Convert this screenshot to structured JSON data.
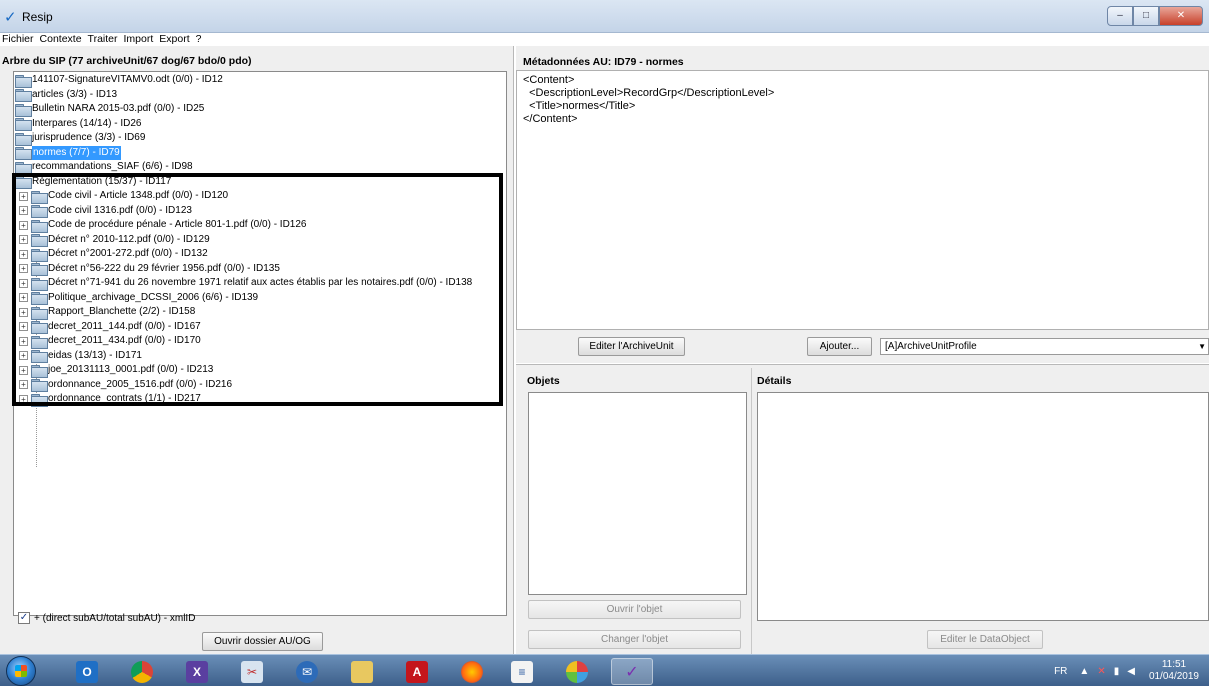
{
  "window": {
    "title": "Resip",
    "controls": {
      "minimize": "–",
      "maximize": "□",
      "close": "✕"
    }
  },
  "menu": [
    "Fichier",
    "Contexte",
    "Traiter",
    "Import",
    "Export",
    "?"
  ],
  "left": {
    "header": "Arbre du SIP (77 archiveUnit/67 dog/67 bdo/0 pdo)",
    "tree_top": [
      {
        "label": "141107-SignatureVITAMV0.odt (0/0) - ID12",
        "selected": false
      },
      {
        "label": "articles (3/3) - ID13",
        "selected": false
      },
      {
        "label": "Bulletin NARA 2015-03.pdf (0/0) - ID25",
        "selected": false
      },
      {
        "label": "Interpares (14/14) - ID26",
        "selected": false
      },
      {
        "label": "jurisprudence (3/3) - ID69",
        "selected": false
      },
      {
        "label": "normes (7/7) - ID79",
        "selected": true
      },
      {
        "label": "recommandations_SIAF (6/6) - ID98",
        "selected": false
      },
      {
        "label": "Réglementation (15/37) - ID117",
        "selected": false
      }
    ],
    "tree_children": [
      "Code civil - Article 1348.pdf (0/0) - ID120",
      "Code civil 1316.pdf (0/0) - ID123",
      "Code de procédure pénale - Article 801-1.pdf (0/0) - ID126",
      "Décret n° 2010-112.pdf (0/0) - ID129",
      "Décret n°2001-272.pdf (0/0) - ID132",
      "Décret n°56-222 du 29 février 1956.pdf (0/0) - ID135",
      "Décret n°71-941 du 26 novembre 1971 relatif aux actes établis par les notaires.pdf (0/0) - ID138",
      "Politique_archivage_DCSSI_2006 (6/6) - ID139",
      "Rapport_Blanchette (2/2) - ID158",
      "decret_2011_144.pdf (0/0) - ID167",
      "decret_2011_434.pdf (0/0) - ID170",
      "eidas (13/13) - ID171",
      "joe_20131113_0001.pdf (0/0) - ID213",
      "ordonnance_2005_1516.pdf (0/0) - ID216",
      "ordonnance_contrats (1/1) - ID217"
    ],
    "checkbox_label": "+ (direct subAU/total subAU) - xmlID",
    "checkbox_checked": true,
    "open_button": "Ouvrir dossier AU/OG"
  },
  "right": {
    "metadata_header": "Métadonnées AU: ID79 - normes",
    "xml_lines": [
      "<Content>",
      "  <DescriptionLevel>RecordGrp</DescriptionLevel>",
      "  <Title>normes</Title>",
      "</Content>"
    ],
    "edit_button": "Editer l'ArchiveUnit",
    "add_button": "Ajouter...",
    "profile_select": "[A]ArchiveUnitProfile",
    "objets_header": "Objets",
    "details_header": "Détails",
    "open_object_button": "Ouvrir l'objet",
    "change_object_button": "Changer l'objet",
    "edit_dataobject_button": "Editer le DataObject"
  },
  "taskbar": {
    "lang": "FR",
    "time": "11:51",
    "date": "01/04/2019"
  }
}
